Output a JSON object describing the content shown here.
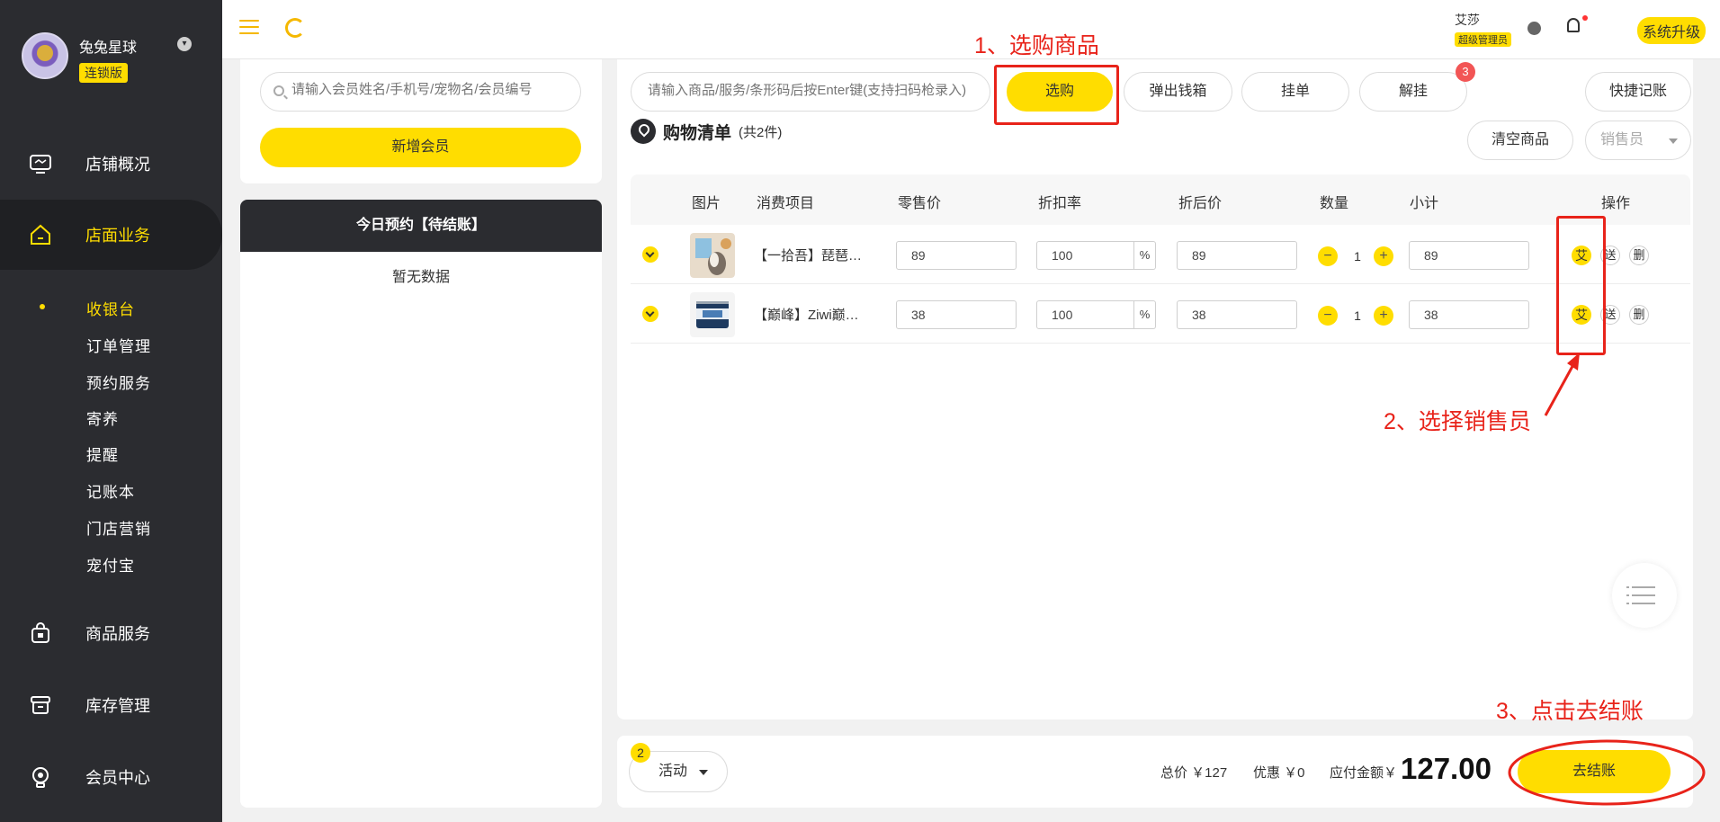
{
  "brand": {
    "name": "兔兔星球",
    "edition": "连锁版"
  },
  "nav": {
    "items": [
      {
        "label": "店铺概况",
        "icon": "monitor-icon"
      },
      {
        "label": "店面业务",
        "icon": "home-icon"
      },
      {
        "label": "商品服务",
        "icon": "bag-icon"
      },
      {
        "label": "库存管理",
        "icon": "box-icon"
      },
      {
        "label": "会员中心",
        "icon": "user-icon"
      }
    ],
    "sub_items": [
      "收银台",
      "订单管理",
      "预约服务",
      "寄养",
      "提醒",
      "记账本",
      "门店营销",
      "宠付宝"
    ]
  },
  "topbar": {
    "user_name": "艾莎",
    "user_role": "超级管理员",
    "upgrade_label": "系统升级"
  },
  "member": {
    "search_placeholder": "请输入会员姓名/手机号/宠物名/会员编号",
    "add_label": "新增会员"
  },
  "appointments": {
    "title": "今日预约【待结账】",
    "empty": "暂无数据"
  },
  "toolbar": {
    "product_search_placeholder": "请输入商品/服务/条形码后按Enter键(支持扫码枪录入)",
    "select_label": "选购",
    "cash_drawer_label": "弹出钱箱",
    "hold_label": "挂单",
    "unhold_label": "解挂",
    "unhold_badge": "3",
    "quick_bill_label": "快捷记账"
  },
  "cart": {
    "title": "购物清单",
    "count": "(共2件)",
    "clear_label": "清空商品",
    "seller_placeholder": "销售员",
    "columns": [
      "图片",
      "消费项目",
      "零售价",
      "折扣率",
      "折后价",
      "数量",
      "小计",
      "操作"
    ],
    "rows": [
      {
        "name": "【一拾吾】琵琶腿冻干",
        "retail": "89",
        "discount": "100",
        "pct": "%",
        "discounted": "89",
        "qty": "1",
        "subtotal": "89",
        "op_seller": "艾",
        "op_gift": "送",
        "op_delete": "删"
      },
      {
        "name": "【巅峰】Ziwi巅峰罐头",
        "retail": "38",
        "discount": "100",
        "pct": "%",
        "discounted": "38",
        "qty": "1",
        "subtotal": "38",
        "op_seller": "艾",
        "op_gift": "送",
        "op_delete": "删"
      }
    ],
    "minus": "−",
    "plus": "+"
  },
  "summary": {
    "activity_label": "活动",
    "activity_badge": "2",
    "total": "总价 ￥127",
    "discount": "优惠 ￥0",
    "payable_label": "应付金额￥",
    "payable_amount": "127.00",
    "checkout_label": "去结账"
  },
  "annotations": {
    "step1": "1、选购商品",
    "step2": "2、选择销售员",
    "step3": "3、点击去结账",
    "color": "#e8231a"
  },
  "colors": {
    "accent": "#ffdd00",
    "sidebar": "#2b2c30"
  }
}
